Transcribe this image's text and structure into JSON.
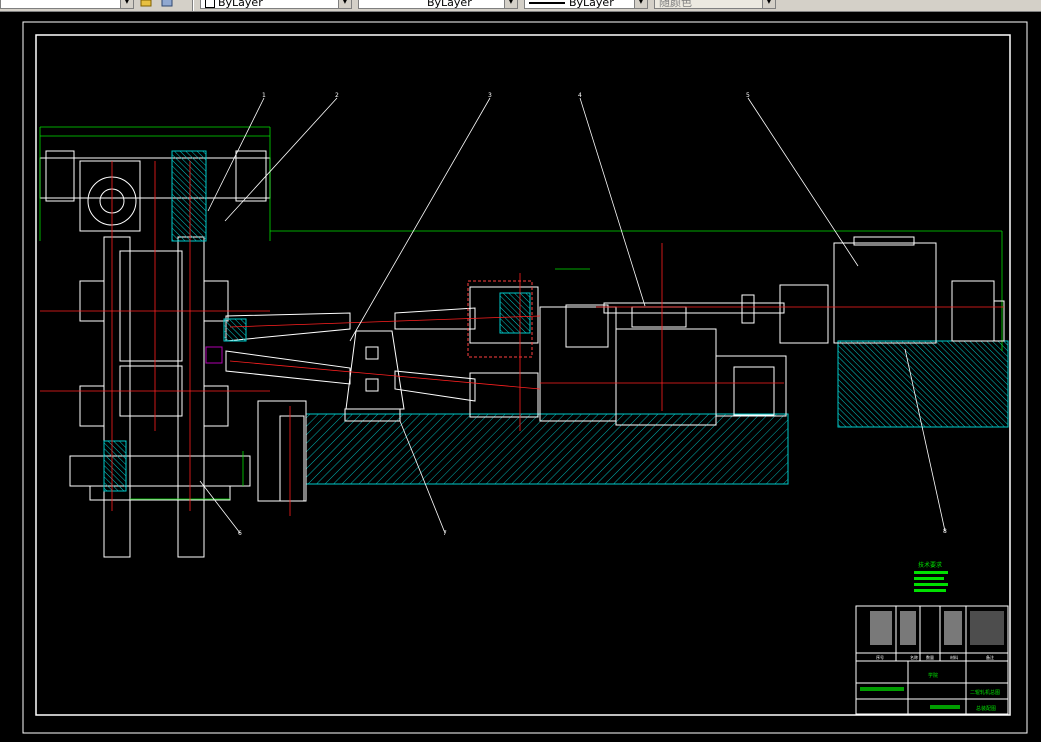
{
  "toolbar": {
    "layer_color": "ByLayer",
    "layer_linetype": "ByLayer",
    "layer_lineweight": "ByLayer",
    "plot_style": "随颜色"
  },
  "drawing": {
    "background": "#000000",
    "colors": {
      "frame": "#ffffff",
      "outline": "#ffffff",
      "centerline": "#ff2020",
      "dimension": "#00e000",
      "hatch": "#00c8c8",
      "section": "#ff4040",
      "accent": "#b000b0",
      "text": "#ffffff",
      "table_fill": "#00e000"
    },
    "balloons": [
      "1",
      "2",
      "3",
      "4",
      "5",
      "6",
      "7",
      "8"
    ]
  },
  "title_block": {
    "col_headers": [
      "序号",
      "名称",
      "数量",
      "材料",
      "备注"
    ],
    "school": "学院",
    "drawing_title": "二辊轧机总图",
    "drawing_no": "总装配图"
  },
  "tech_req": {
    "title": "技术要求"
  }
}
